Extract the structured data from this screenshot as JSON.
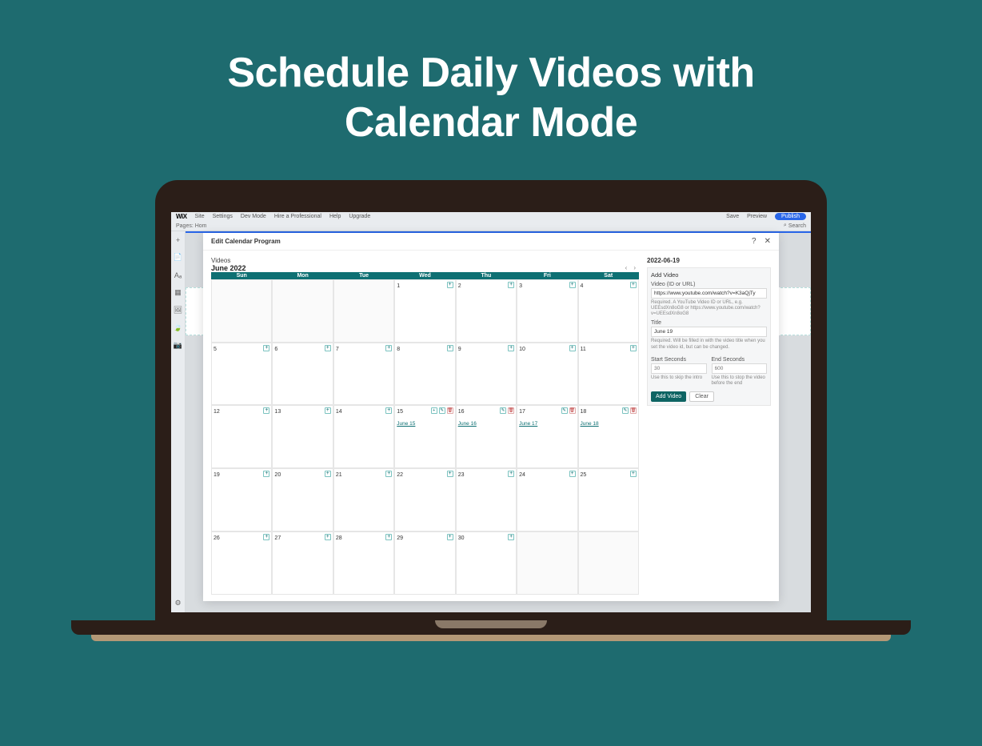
{
  "hero": {
    "title_line1": "Schedule Daily Videos with",
    "title_line2": "Calendar Mode"
  },
  "wix_topbar": {
    "logo": "WiX",
    "menu": [
      "Site",
      "Settings",
      "Dev Mode",
      "Hire a Professional",
      "Help",
      "Upgrade"
    ],
    "right": [
      "Save",
      "Preview"
    ],
    "publish": "Publish"
  },
  "wix_subbar": {
    "pages": "Pages: Hom",
    "search": "Search",
    "search_icon": "⌕"
  },
  "sidebar_icons": [
    "+",
    "📄",
    "Aₐ",
    "▦",
    "🖼",
    "🍃",
    "📷"
  ],
  "sidebar_gear": "⚙",
  "modal": {
    "title": "Edit Calendar Program",
    "help": "?",
    "close": "✕",
    "videos_label": "Videos",
    "month": "June 2022",
    "weekdays": [
      "Sun",
      "Mon",
      "Tue",
      "Wed",
      "Thu",
      "Fri",
      "Sat"
    ],
    "plus": "+",
    "weeks": [
      [
        {
          "blank": true
        },
        {
          "blank": true
        },
        {
          "blank": true
        },
        {
          "d": "1"
        },
        {
          "d": "2"
        },
        {
          "d": "3"
        },
        {
          "d": "4"
        }
      ],
      [
        {
          "d": "5"
        },
        {
          "d": "6"
        },
        {
          "d": "7"
        },
        {
          "d": "8"
        },
        {
          "d": "9"
        },
        {
          "d": "10"
        },
        {
          "d": "11"
        }
      ],
      [
        {
          "d": "12"
        },
        {
          "d": "13"
        },
        {
          "d": "14"
        },
        {
          "d": "15",
          "ev": "June 15",
          "plus": true
        },
        {
          "d": "16",
          "ev": "June 16"
        },
        {
          "d": "17",
          "ev": "June 17"
        },
        {
          "d": "18",
          "ev": "June 18"
        }
      ],
      [
        {
          "d": "19"
        },
        {
          "d": "20"
        },
        {
          "d": "21"
        },
        {
          "d": "22"
        },
        {
          "d": "23"
        },
        {
          "d": "24"
        },
        {
          "d": "25"
        }
      ],
      [
        {
          "d": "26"
        },
        {
          "d": "27"
        },
        {
          "d": "28"
        },
        {
          "d": "29"
        },
        {
          "d": "30"
        },
        {
          "blank": true
        },
        {
          "blank": true
        }
      ]
    ],
    "edit_icon": "✎",
    "delete_icon": "🗑",
    "arrow_left": "‹",
    "arrow_right": "›"
  },
  "panel": {
    "date": "2022-06-19",
    "title": "Add Video",
    "video_label": "Video (ID or URL)",
    "video_value": "https://www.youtube.com/watch?v=K3aQjTy",
    "video_help": "Required. A YouTube Video ID or URL, e.g. UEEsdXn8oG8 or https://www.youtube.com/watch?v=UEEsdXn8oG8",
    "title_label": "Title",
    "title_value": "June 19",
    "title_help": "Required. Will be filled in with the video title when you set the video id, but can be changed.",
    "start_label": "Start Seconds",
    "start_placeholder": "30",
    "start_help": "Use this to skip the intro",
    "end_label": "End Seconds",
    "end_placeholder": "600",
    "end_help": "Use this to stop the video before the end",
    "add_btn": "Add Video",
    "clear_btn": "Clear"
  }
}
